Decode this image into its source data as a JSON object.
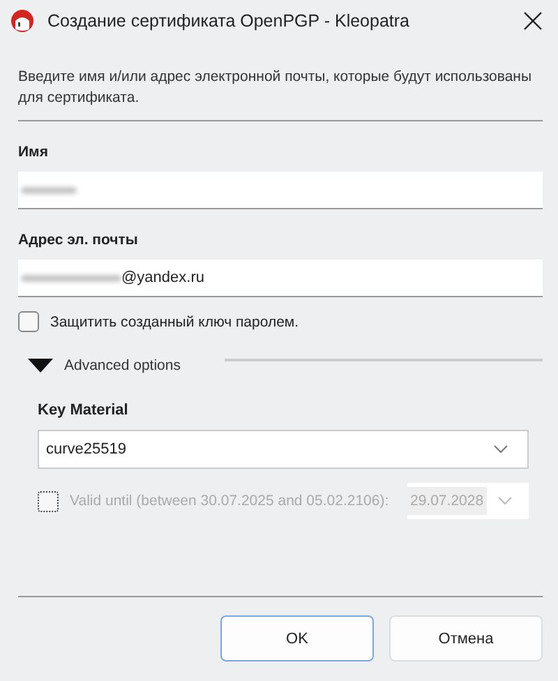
{
  "window": {
    "title": "Создание сертификата OpenPGP - Kleopatra"
  },
  "intro": "Введите имя и/или адрес электронной почты, которые будут использованы для сертификата.",
  "name_field": {
    "label": "Имя",
    "redacted": true
  },
  "email_field": {
    "label": "Адрес эл. почты",
    "value": "@yandex.ru",
    "redacted_prefix": true
  },
  "protect_checkbox": {
    "label": "Защитить созданный ключ паролем.",
    "checked": false
  },
  "advanced": {
    "label": "Advanced options",
    "expanded": true,
    "key_material": {
      "label": "Key Material",
      "value": "curve25519"
    },
    "valid_until": {
      "label": "Valid until (between 30.07.2025 and 05.02.2106):",
      "checked": false,
      "disabled": true,
      "value": "29.07.2028"
    }
  },
  "buttons": [
    {
      "label": "OK",
      "kind": "default"
    },
    {
      "label": "Отмена",
      "kind": "normal"
    }
  ]
}
